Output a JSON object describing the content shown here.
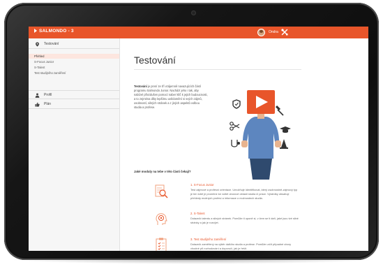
{
  "app": {
    "brand": "SALMONDO - 3",
    "user_name": "Ondra"
  },
  "sidebar": {
    "sections": [
      {
        "label": "Testování",
        "icon": "map-pin-icon"
      },
      {
        "label": "Profil",
        "icon": "person-icon"
      },
      {
        "label": "Plán",
        "icon": "thumbs-up-icon"
      }
    ],
    "sub_items": [
      {
        "label": "Přehled"
      },
      {
        "label": "S-Focus Junior"
      },
      {
        "label": "S-Talent"
      },
      {
        "label": "Test studijního zaměření"
      }
    ]
  },
  "main": {
    "title": "Testování",
    "intro_bold": "Testování",
    "intro_rest": " je první ze tří vzájemně navazujících částí programu Salmondo Junior. Nachází jeho i tak, aby nabízel přivzdušen pomocí naber klíč k jejich budoucnosti, a to zejména díky lepšímu uvědomění si svých zájmů, osobností, silných stránek a z jiných aspektů volbou studia a profese.",
    "question": "Jaké moduly na tebe v této části čekají?",
    "modules": [
      {
        "title": "1. S-Focus Junior",
        "text": "Test zájmové a profesní orientace. Umožňuje identifikovat, který osobnostně-zájmový typ je ten tobě je promítne ke volbě oborové oblasti studia či práce. Výsledky obsahují přehledy možných profesí a informace o možnostech studia.",
        "icon": "magnifier-document-icon"
      },
      {
        "title": "2. S-Talent",
        "text": "Dotazník talentu a silných stránek. Pomůže ti uponě si, v čem se ti daří, jaké jsou tvé silné stránky a jak je rozvíjet.",
        "icon": "target-head-icon"
      },
      {
        "title": "3. Test studijního zaměření",
        "text": "Dotazník zaměřený na výběr dalšího studia a profese. Pomůže určit případné obory vhodné při rozhodování a doporučí, jak je řešit.",
        "icon": "clipboard-list-icon"
      }
    ]
  },
  "colors": {
    "accent": "#e8552a",
    "sidebar_bg": "#f6f6f6",
    "active_bg": "#fde6df",
    "bezel": "#111111"
  }
}
